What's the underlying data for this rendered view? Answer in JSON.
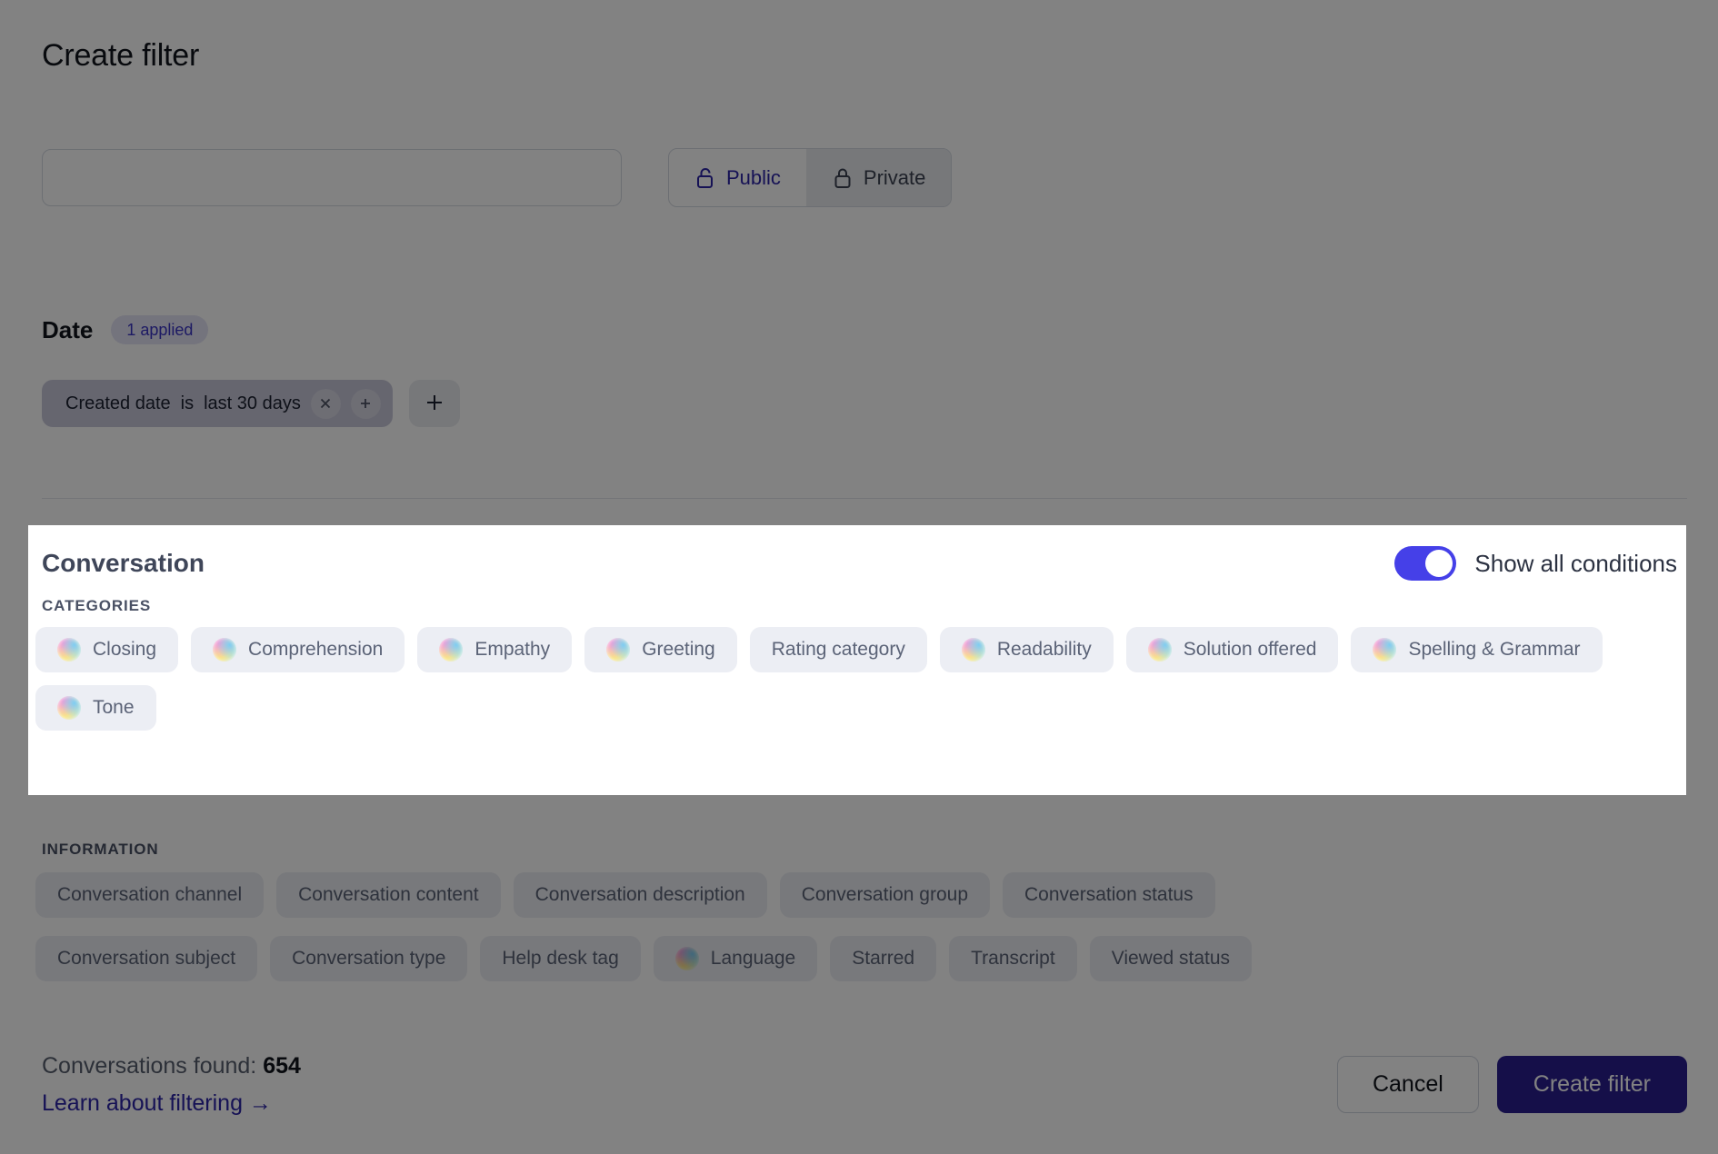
{
  "header": {
    "title": "Create filter",
    "name_input_value": "",
    "name_input_placeholder": ""
  },
  "visibility": {
    "public_label": "Public",
    "private_label": "Private",
    "selected": "Public"
  },
  "date_section": {
    "label": "Date",
    "applied_badge": "1 applied",
    "chip": {
      "field": "Created date",
      "operator": "is",
      "value": "last 30 days",
      "remove_icon": "close-icon",
      "duplicate_icon": "plus-icon"
    },
    "add_condition_icon": "plus-icon"
  },
  "conversation_section": {
    "title": "Conversation",
    "toggle_label": "Show all conditions",
    "toggle_on": true,
    "categories_label": "CATEGORIES",
    "categories": [
      {
        "label": "Closing",
        "has_ai_orb": true
      },
      {
        "label": "Comprehension",
        "has_ai_orb": true
      },
      {
        "label": "Empathy",
        "has_ai_orb": true
      },
      {
        "label": "Greeting",
        "has_ai_orb": true
      },
      {
        "label": "Rating category",
        "has_ai_orb": false
      },
      {
        "label": "Readability",
        "has_ai_orb": true
      },
      {
        "label": "Solution offered",
        "has_ai_orb": true
      },
      {
        "label": "Spelling & Grammar",
        "has_ai_orb": true
      },
      {
        "label": "Tone",
        "has_ai_orb": true
      }
    ]
  },
  "information_section": {
    "label": "INFORMATION",
    "row1": [
      {
        "label": "Conversation channel",
        "has_ai_orb": false
      },
      {
        "label": "Conversation content",
        "has_ai_orb": false
      },
      {
        "label": "Conversation description",
        "has_ai_orb": false
      },
      {
        "label": "Conversation group",
        "has_ai_orb": false
      },
      {
        "label": "Conversation status",
        "has_ai_orb": false
      }
    ],
    "row2": [
      {
        "label": "Conversation subject",
        "has_ai_orb": false
      },
      {
        "label": "Conversation type",
        "has_ai_orb": false
      },
      {
        "label": "Help desk tag",
        "has_ai_orb": false
      },
      {
        "label": "Language",
        "has_ai_orb": true
      },
      {
        "label": "Starred",
        "has_ai_orb": false
      },
      {
        "label": "Transcript",
        "has_ai_orb": false
      },
      {
        "label": "Viewed status",
        "has_ai_orb": false
      }
    ]
  },
  "footer": {
    "found_prefix": "Conversations found:",
    "found_count": "654",
    "learn_link": "Learn about filtering →",
    "cancel_label": "Cancel",
    "create_label": "Create filter"
  },
  "colors": {
    "accent_indigo": "#2a1f8f",
    "toggle_on": "#4540e8",
    "chip_bg": "#eceef4",
    "badge_bg": "#e4e3f5",
    "dim_overlay": "rgba(0,0,0,0.49)"
  }
}
